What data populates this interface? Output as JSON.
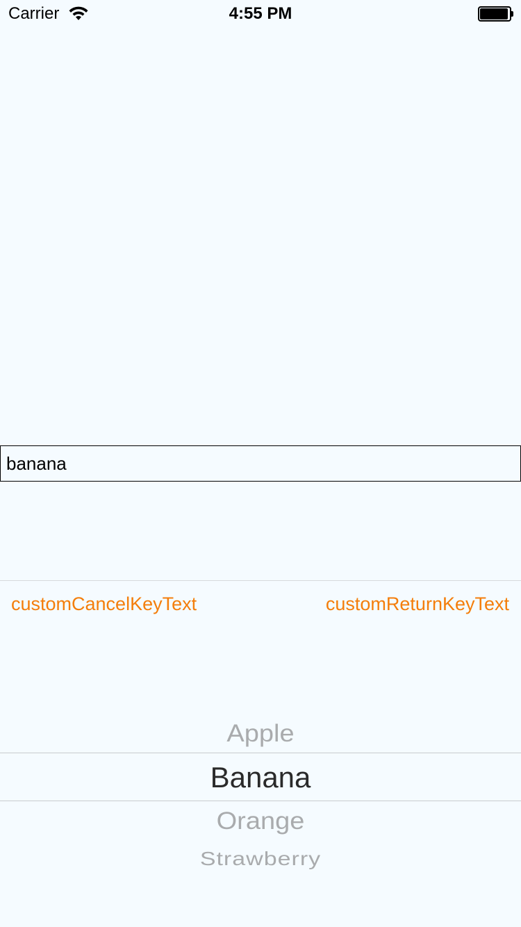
{
  "status_bar": {
    "carrier": "Carrier",
    "time": "4:55 PM"
  },
  "text_field": {
    "value": "banana"
  },
  "toolbar": {
    "cancel_label": "customCancelKeyText",
    "return_label": "customReturnKeyText"
  },
  "picker": {
    "items": [
      "Apple",
      "Banana",
      "Orange",
      "Strawberry"
    ],
    "selected": "Banana"
  },
  "colors": {
    "background": "#F5FBFF",
    "accent": "#F47E0B",
    "picker_selected": "#2A2A2A",
    "picker_unselected": "#A9ABAD"
  },
  "icons": [
    "wifi-icon",
    "battery-icon"
  ]
}
